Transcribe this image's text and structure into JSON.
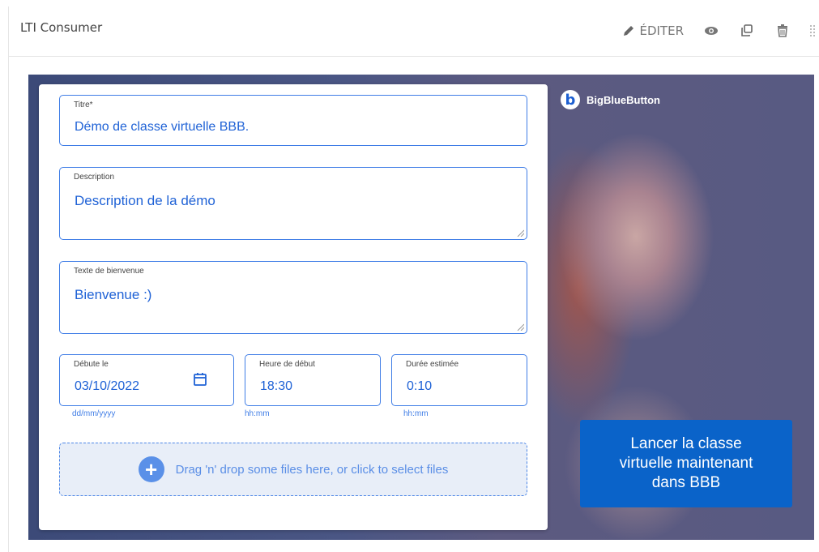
{
  "header": {
    "title": "LTI Consumer",
    "edit_label": "ÉDITER",
    "icons": [
      "pencil-icon",
      "eye-icon",
      "duplicate-icon",
      "trash-icon",
      "drag-handle-icon"
    ]
  },
  "banner": {
    "logo_text": "BigBlueButton",
    "logo_letter": "b"
  },
  "form": {
    "title": {
      "label": "Titre*",
      "value": "Démo de classe virtuelle BBB."
    },
    "description": {
      "label": "Description",
      "value": "Description de la démo"
    },
    "welcome": {
      "label": "Texte de bienvenue",
      "value": "Bienvenue :)"
    },
    "start_date": {
      "label": "Débute le",
      "value": "03/10/2022",
      "hint": "dd/mm/yyyy"
    },
    "start_time": {
      "label": "Heure de début",
      "value": "18:30",
      "hint": "hh:mm"
    },
    "duration": {
      "label": "Durée estimée",
      "value": "0:10",
      "hint": "hh:mm"
    },
    "dropzone_text": "Drag 'n' drop some files here, or click to select files"
  },
  "launch_button": "Lancer la classe\nvirtuelle maintenant\ndans BBB",
  "colors": {
    "accent": "#3f7de6",
    "button": "#0a63c9",
    "value_text": "#1f62d6"
  }
}
